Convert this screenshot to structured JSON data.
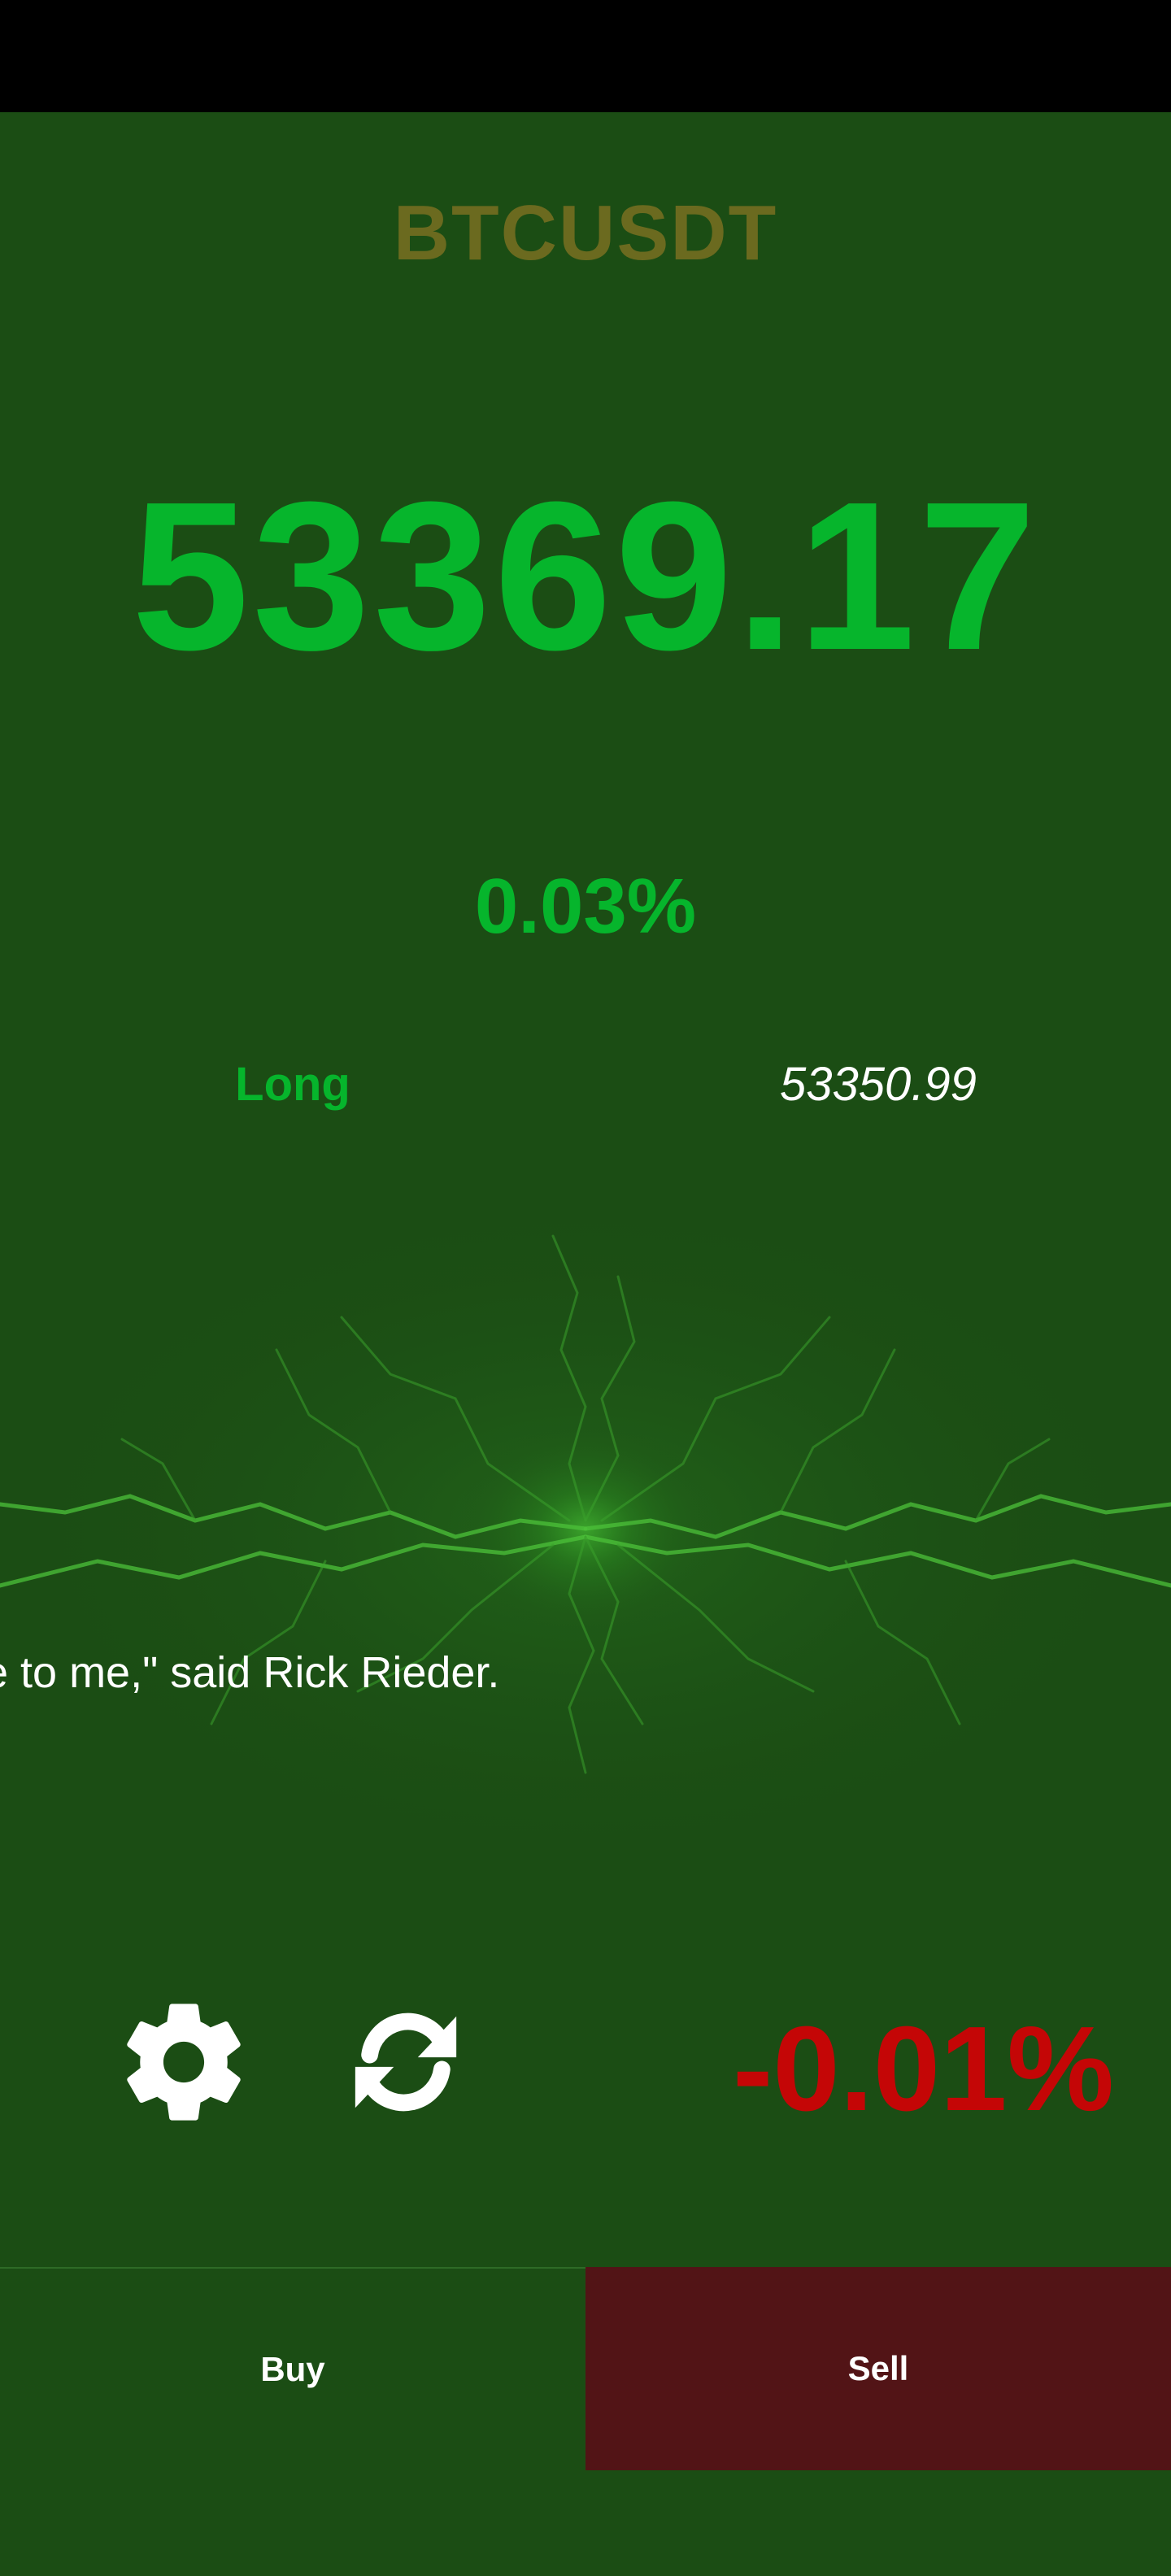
{
  "header": {
    "symbol": "BTCUSDT"
  },
  "ticker": {
    "price": "53369.17",
    "change_percent": "0.03%"
  },
  "position": {
    "side": "Long",
    "entry_price": "53350.99",
    "pnl_percent": "-0.01%"
  },
  "news": {
    "text": "e to me,\" said Rick Rieder."
  },
  "actions": {
    "buy_label": "Buy",
    "sell_label": "Sell"
  },
  "icons": {
    "settings": "gear-icon",
    "refresh": "refresh-icon"
  },
  "colors": {
    "background": "#1b4d14",
    "symbol": "#6b6a1f",
    "positive": "#06b52c",
    "negative": "#c40606",
    "sell_button": "#521416",
    "text": "#ffffff"
  }
}
